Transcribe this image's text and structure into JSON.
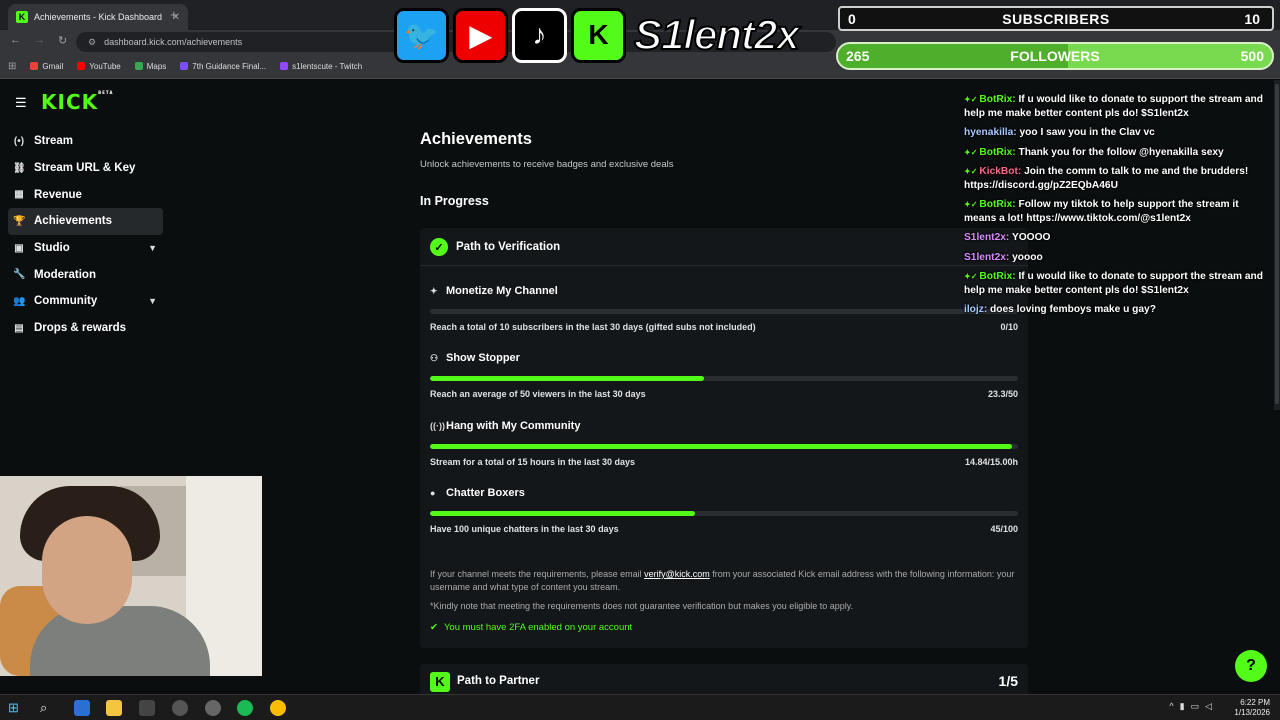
{
  "browser": {
    "tab_title": "Achievements - Kick Dashboard",
    "tab_close": "✕",
    "new_tab": "+",
    "url": "dashboard.kick.com/achievements",
    "bookmarks": [
      "Gmail",
      "YouTube",
      "Maps",
      "7th Guidance Final...",
      "s1lentscute - Twitch"
    ]
  },
  "overlay": {
    "channel_name": "S1lent2x",
    "subscribers": {
      "current": "0",
      "label": "SUBSCRIBERS",
      "goal": "10",
      "progress": 0
    },
    "followers": {
      "current": "265",
      "label": "FOLLOWERS",
      "goal": "500",
      "progress": 0.53
    }
  },
  "sidebar": {
    "logo": "KICK",
    "logo_tag": "BETA",
    "items": [
      {
        "label": "Stream",
        "icon": "stream-icon",
        "glyph": "(•)"
      },
      {
        "label": "Stream URL & Key",
        "icon": "link-icon",
        "glyph": "⛓"
      },
      {
        "label": "Revenue",
        "icon": "revenue-icon",
        "glyph": "▦"
      },
      {
        "label": "Achievements",
        "icon": "trophy-icon",
        "glyph": "🏆"
      },
      {
        "label": "Studio",
        "icon": "studio-icon",
        "glyph": "▣"
      },
      {
        "label": "Moderation",
        "icon": "wrench-icon",
        "glyph": "🔧"
      },
      {
        "label": "Community",
        "icon": "community-icon",
        "glyph": "👥"
      },
      {
        "label": "Drops & rewards",
        "icon": "gift-icon",
        "glyph": "▤"
      }
    ]
  },
  "main": {
    "title": "Achievements",
    "subtitle": "Unlock achievements to receive badges and exclusive deals",
    "section": "In Progress",
    "card_title": "Path to Verification",
    "achievements": [
      {
        "name": "Monetize My Channel",
        "icon": "sparkle-icon",
        "desc": "Reach a total of 10 subscribers in the last 30 days (gifted subs not included)",
        "value": "0/10",
        "progress": 0
      },
      {
        "name": "Show Stopper",
        "icon": "viewers-icon",
        "desc": "Reach an average of 50 viewers in the last 30 days",
        "value": "23.3/50",
        "progress": 0.466
      },
      {
        "name": "Hang with My Community",
        "icon": "broadcast-icon",
        "desc": "Stream for a total of 15 hours in the last 30 days",
        "value": "14.84/15.00h",
        "progress": 0.989
      },
      {
        "name": "Chatter Boxers",
        "icon": "chat-icon",
        "desc": "Have 100 unique chatters in the last 30 days",
        "value": "45/100",
        "progress": 0.45
      }
    ],
    "info_pre": "If your channel meets the requirements, please email ",
    "info_email": "verify@kick.com",
    "info_post": " from your associated Kick email address with the following information: your username and what type of content you stream.",
    "note": "*Kindly note that meeting the requirements does not guarantee verification but makes you eligible to apply.",
    "twofa": "You must have 2FA enabled on your account",
    "partner_title": "Path to Partner",
    "partner_count": "1/5"
  },
  "chat": [
    {
      "user": "BotRix",
      "color": "#53fc18",
      "bot": true,
      "text": "If u would like to donate to support the stream and help me make better content pls do! $S1lent2x"
    },
    {
      "user": "hyenakilla",
      "color": "#a8c8ff",
      "bot": false,
      "text": "yoo I saw you in the Clav vc"
    },
    {
      "user": "BotRix",
      "color": "#53fc18",
      "bot": true,
      "text": "Thank you for the follow @hyenakilla sexy"
    },
    {
      "user": "KickBot",
      "color": "#ff6a8a",
      "bot": true,
      "text": "Join the comm to talk to me and the brudders! https://discord.gg/pZ2EQbA46U"
    },
    {
      "user": "BotRix",
      "color": "#53fc18",
      "bot": true,
      "text": "Follow my tiktok to help support the stream it means a lot! https://www.tiktok.com/@s1lent2x"
    },
    {
      "user": "S1lent2x",
      "color": "#d58cff",
      "bot": false,
      "text": "YOOOO"
    },
    {
      "user": "S1lent2x",
      "color": "#d58cff",
      "bot": false,
      "text": "yoooo"
    },
    {
      "user": "BotRix",
      "color": "#53fc18",
      "bot": true,
      "text": "If u would like to donate to support the stream and help me make better content pls do! $S1lent2x"
    },
    {
      "user": "ilojz",
      "color": "#a8c8ff",
      "bot": false,
      "text": "does loving femboys make u gay?"
    }
  ],
  "taskbar": {
    "time": "6:22 PM",
    "date": "1/13/2026"
  },
  "colors": {
    "accent": "#53fc18",
    "bg": "#0b0e0f",
    "card": "#141719"
  }
}
